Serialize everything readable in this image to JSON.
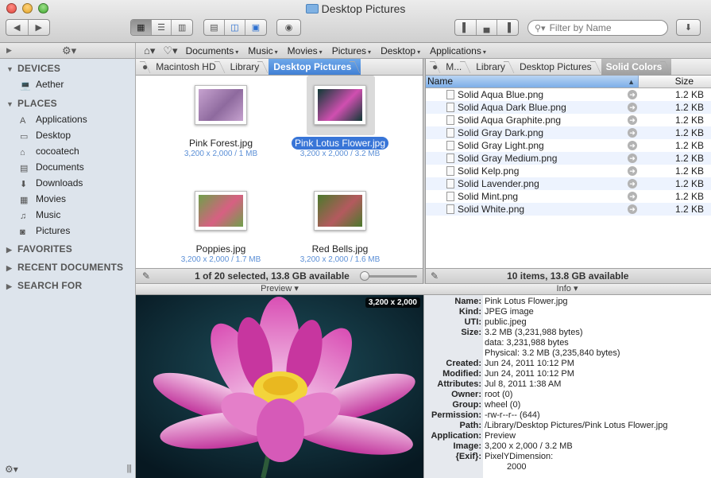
{
  "window": {
    "title": "Desktop Pictures"
  },
  "toolbar": {
    "filter_placeholder": "Filter by Name"
  },
  "menus": [
    "Documents",
    "Music",
    "Movies",
    "Pictures",
    "Desktop",
    "Applications"
  ],
  "sidebar": {
    "sections": [
      {
        "label": "DEVICES",
        "expanded": true,
        "items": [
          {
            "label": "Aether",
            "icon": "laptop-icon"
          }
        ]
      },
      {
        "label": "PLACES",
        "expanded": true,
        "items": [
          {
            "label": "Applications",
            "icon": "applications-icon"
          },
          {
            "label": "Desktop",
            "icon": "desktop-icon"
          },
          {
            "label": "cocoatech",
            "icon": "home-icon"
          },
          {
            "label": "Documents",
            "icon": "documents-icon"
          },
          {
            "label": "Downloads",
            "icon": "downloads-icon"
          },
          {
            "label": "Movies",
            "icon": "movies-icon"
          },
          {
            "label": "Music",
            "icon": "music-icon"
          },
          {
            "label": "Pictures",
            "icon": "pictures-icon"
          }
        ]
      },
      {
        "label": "FAVORITES",
        "expanded": false,
        "items": []
      },
      {
        "label": "RECENT DOCUMENTS",
        "expanded": false,
        "items": []
      },
      {
        "label": "SEARCH FOR",
        "expanded": false,
        "items": []
      }
    ]
  },
  "left_pane": {
    "breadcrumb": [
      "Macintosh HD",
      "Library",
      "Desktop Pictures"
    ],
    "items": [
      {
        "name": "Pink Forest.jpg",
        "info": "3,200 x 2,000 / 1 MB",
        "selected": false,
        "colors": [
          "#c6a2cf",
          "#8e6a9e"
        ]
      },
      {
        "name": "Pink Lotus Flower.jpg",
        "info": "3,200 x 2,000 / 3.2 MB",
        "selected": true,
        "colors": [
          "#0f3a35",
          "#d04fb0"
        ]
      },
      {
        "name": "Poppies.jpg",
        "info": "3,200 x 2,000 / 1.7 MB",
        "selected": false,
        "colors": [
          "#6fa04a",
          "#d76082"
        ]
      },
      {
        "name": "Red Bells.jpg",
        "info": "3,200 x 2,000 / 1.6 MB",
        "selected": false,
        "colors": [
          "#4b7a2c",
          "#b45a5e"
        ]
      }
    ],
    "status": "1 of 20 selected, 13.8 GB available",
    "zoom_level": 0.05
  },
  "right_pane": {
    "breadcrumb": [
      "M...",
      "Library",
      "Desktop Pictures",
      "Solid Colors"
    ],
    "columns": {
      "name": "Name",
      "size": "Size"
    },
    "files": [
      {
        "name": "Solid Aqua Blue.png",
        "size": "1.2 KB"
      },
      {
        "name": "Solid Aqua Dark Blue.png",
        "size": "1.2 KB"
      },
      {
        "name": "Solid Aqua Graphite.png",
        "size": "1.2 KB"
      },
      {
        "name": "Solid Gray Dark.png",
        "size": "1.2 KB"
      },
      {
        "name": "Solid Gray Light.png",
        "size": "1.2 KB"
      },
      {
        "name": "Solid Gray Medium.png",
        "size": "1.2 KB"
      },
      {
        "name": "Solid Kelp.png",
        "size": "1.2 KB"
      },
      {
        "name": "Solid Lavender.png",
        "size": "1.2 KB"
      },
      {
        "name": "Solid Mint.png",
        "size": "1.2 KB"
      },
      {
        "name": "Solid White.png",
        "size": "1.2 KB"
      }
    ],
    "status": "10 items, 13.8 GB available"
  },
  "preview": {
    "header": "Preview",
    "dims": "3,200 x 2,000"
  },
  "info": {
    "header": "Info",
    "rows": [
      {
        "label": "Name:",
        "value": "Pink Lotus Flower.jpg"
      },
      {
        "label": "Kind:",
        "value": "JPEG image"
      },
      {
        "label": "UTI:",
        "value": "public.jpeg"
      },
      {
        "label": "Size:",
        "value": "3.2 MB (3,231,988 bytes)"
      },
      {
        "label": "",
        "value": "data: 3,231,988 bytes"
      },
      {
        "label": "",
        "value": "Physical: 3.2 MB (3,235,840 bytes)"
      },
      {
        "label": "Created:",
        "value": "Jun 24, 2011 10:12 PM"
      },
      {
        "label": "Modified:",
        "value": "Jun 24, 2011 10:12 PM"
      },
      {
        "label": "Attributes:",
        "value": "Jul 8, 2011 1:38 AM"
      },
      {
        "label": "Owner:",
        "value": "root (0)"
      },
      {
        "label": "Group:",
        "value": "wheel (0)"
      },
      {
        "label": "Permission:",
        "value": "-rw-r--r-- (644)"
      },
      {
        "label": "Path:",
        "value": "/Library/Desktop Pictures/Pink Lotus Flower.jpg"
      },
      {
        "label": "Application:",
        "value": "Preview"
      },
      {
        "label": "Image:",
        "value": "3,200 x 2,000 / 3.2 MB"
      },
      {
        "label": "{Exif}:",
        "value": "PixelYDimension:"
      },
      {
        "label": "",
        "value": "    2000"
      }
    ]
  }
}
